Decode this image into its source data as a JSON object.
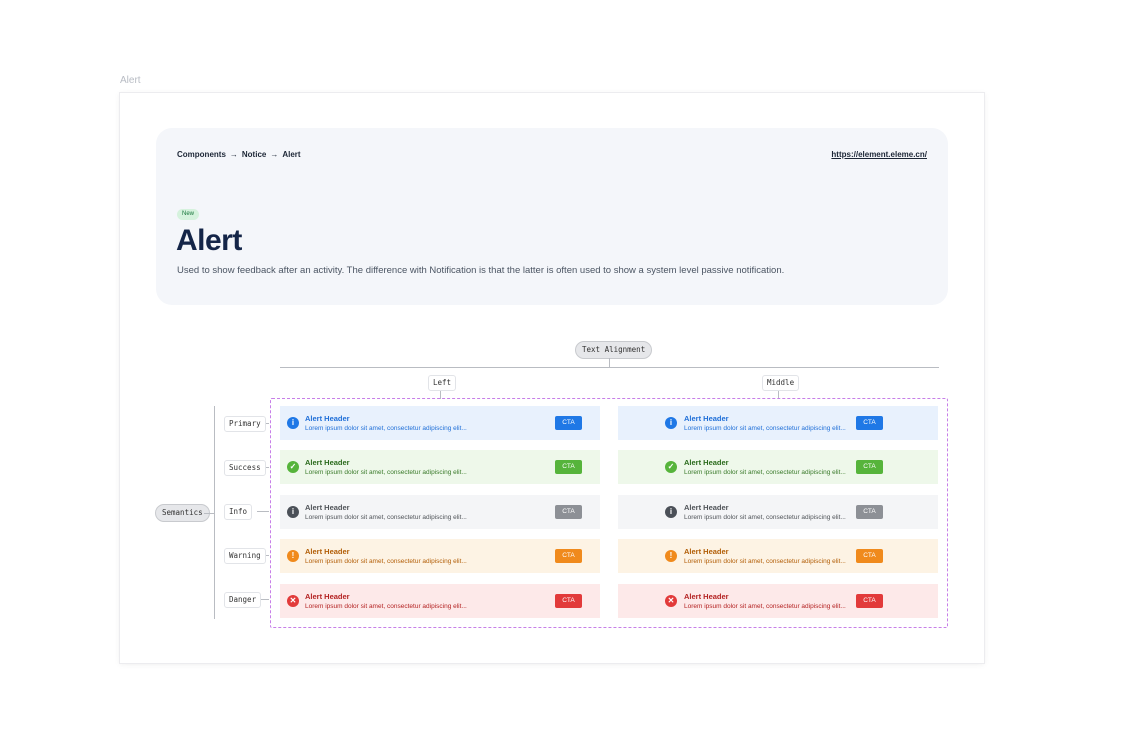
{
  "frame_label": "Alert",
  "hero": {
    "breadcrumb": [
      "Components",
      "Notice",
      "Alert"
    ],
    "breadcrumb_separator": "→",
    "link": "https://element.eleme.cn/",
    "badge": "New",
    "title": "Alert",
    "description": "Used to show feedback after an activity. The difference with Notification is that the latter is often used to show a system level passive notification."
  },
  "diagram": {
    "alignment_label": "Text Alignment",
    "alignments": [
      "Left",
      "Middle"
    ],
    "semantics_label": "Semantics",
    "semantics": [
      "Primary",
      "Success",
      "Info",
      "Warning",
      "Danger"
    ]
  },
  "alert": {
    "header": "Alert Header",
    "body": "Lorem ipsum dolor sit amet, consectetur adipiscing elit...",
    "cta": "CTA"
  },
  "icons": {
    "primary": "info-icon",
    "success": "check-circle-icon",
    "info": "info-icon",
    "warning": "exclamation-icon",
    "danger": "close-circle-icon"
  },
  "colors": {
    "primary": "#1f78e6",
    "success": "#56b43b",
    "info": "#8d9096",
    "warning": "#f08a1c",
    "danger": "#e23a3a",
    "guide": "#c77fe8"
  }
}
